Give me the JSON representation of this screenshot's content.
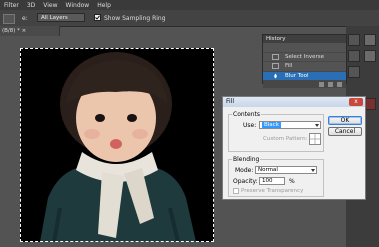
{
  "menubar": {
    "items": [
      "Filter",
      "3D",
      "View",
      "Window",
      "Help"
    ]
  },
  "options_bar": {
    "sample_label": "e:",
    "sample_value": "All Layers",
    "show_ring_label": "Show Sampling Ring",
    "show_ring_checked": true
  },
  "document_tab": {
    "title": "(B/8) * ×"
  },
  "history": {
    "title": "History",
    "rows": [
      {
        "label": "",
        "selected": false
      },
      {
        "label": "Select Inverse",
        "selected": false
      },
      {
        "label": "Fill",
        "selected": false
      },
      {
        "label": "Blur Tool",
        "selected": true
      }
    ]
  },
  "fill_dialog": {
    "title": "Fill",
    "close_label": "x",
    "contents_group": "Contents",
    "use_label": "Use:",
    "use_value": "Black",
    "custom_pattern_label": "Custom Pattern:",
    "blending_group": "Blending",
    "mode_label": "Mode:",
    "mode_value": "Normal",
    "opacity_label": "Opacity:",
    "opacity_value": "100",
    "opacity_unit": "%",
    "preserve_label": "Preserve Transparency",
    "ok_label": "OK",
    "cancel_label": "Cancel"
  },
  "colors": {
    "selection_blue": "#2a6fb5",
    "dialog_bg": "#f0f0f0",
    "close_red": "#c9483c",
    "app_bg": "#535353"
  }
}
